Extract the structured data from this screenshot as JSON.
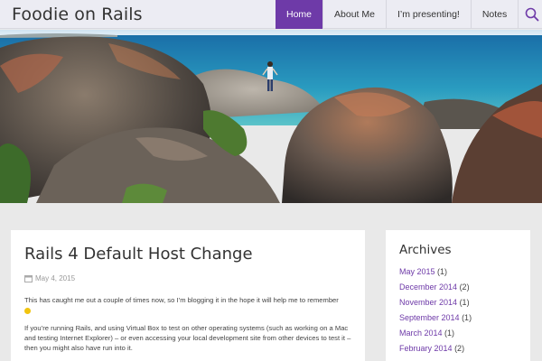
{
  "site": {
    "title": "Foodie on Rails"
  },
  "nav": {
    "items": [
      {
        "label": "Home",
        "active": true
      },
      {
        "label": "About Me",
        "active": false
      },
      {
        "label": "I’m presenting!",
        "active": false
      },
      {
        "label": "Notes",
        "active": false
      }
    ],
    "search_icon": "search-icon"
  },
  "post": {
    "title": "Rails 4 Default Host Change",
    "date": "May 4, 2015",
    "paragraph1": "This has caught me out a couple of times now, so I’m blogging it in the hope it will help me to remember",
    "paragraph2": "If you’re running Rails, and using Virtual Box to test on other operating systems (such as working on a Mac and testing Internet Explorer) – or even accessing your local development site from other devices to test it – then you might also have run into it."
  },
  "sidebar": {
    "title": "Archives",
    "items": [
      {
        "month": "May 2015",
        "count": "(1)"
      },
      {
        "month": "December 2014",
        "count": "(2)"
      },
      {
        "month": "November 2014",
        "count": "(1)"
      },
      {
        "month": "September 2014",
        "count": "(1)"
      },
      {
        "month": "March 2014",
        "count": "(1)"
      },
      {
        "month": "February 2014",
        "count": "(2)"
      }
    ]
  },
  "colors": {
    "accent": "#6e3aa8",
    "header_bg": "#ececf3",
    "page_bg": "#e9e9e9"
  }
}
